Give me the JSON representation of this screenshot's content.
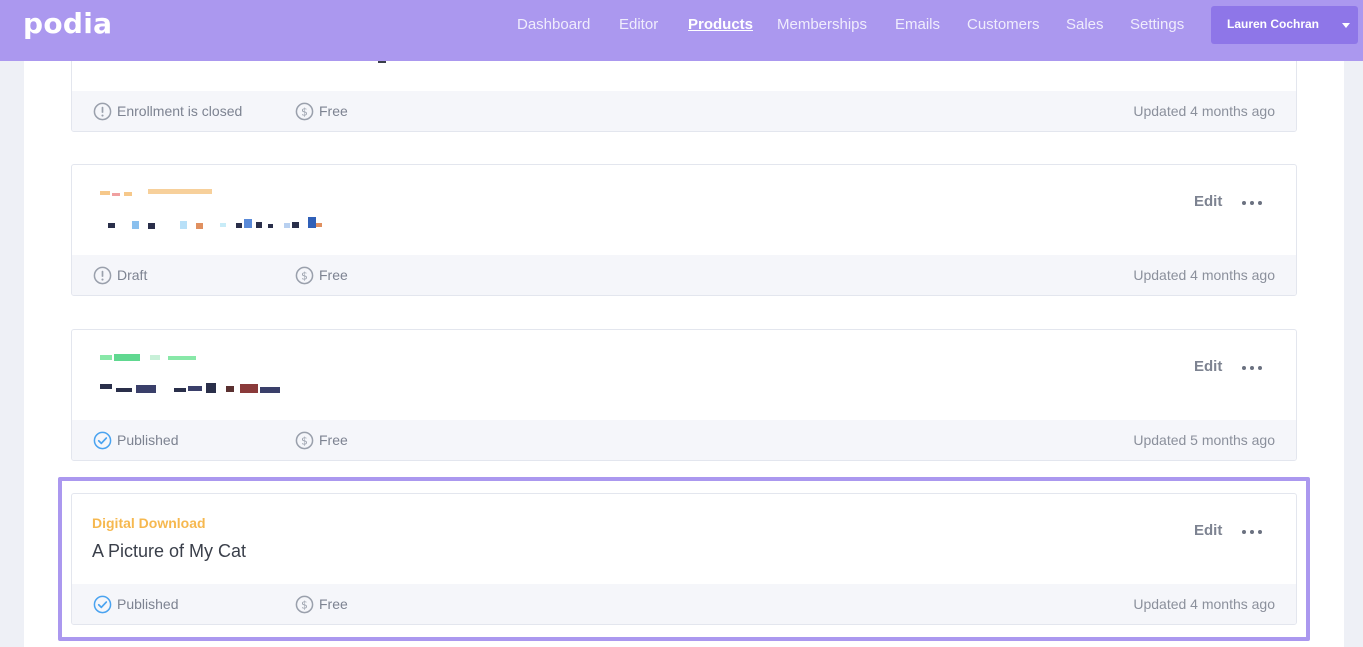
{
  "nav": {
    "logo": "podia",
    "links": [
      "Dashboard",
      "Editor",
      "Products",
      "Memberships",
      "Emails",
      "Customers",
      "Sales",
      "Settings"
    ],
    "active": "Products",
    "user": "Lauren Cochran"
  },
  "products": [
    {
      "status": "Enrollment is closed",
      "status_icon": "exclamation-circle-icon",
      "price": "Free",
      "updated": "Updated 4 months ago"
    },
    {
      "status": "Draft",
      "status_icon": "exclamation-circle-icon",
      "price": "Free",
      "updated": "Updated 4 months ago",
      "edit": "Edit"
    },
    {
      "status": "Published",
      "status_icon": "check-circle-icon",
      "price": "Free",
      "updated": "Updated 5 months ago",
      "edit": "Edit"
    },
    {
      "type": "Digital Download",
      "title": "A Picture of My Cat",
      "status": "Published",
      "status_icon": "check-circle-icon",
      "price": "Free",
      "updated": "Updated 4 months ago",
      "edit": "Edit"
    }
  ],
  "colors": {
    "brand": "#ab98ef",
    "button": "#8e76e8",
    "type_label": "#f6b84f",
    "published": "#4aa3f0",
    "muted_icon": "#9aa0ac"
  }
}
